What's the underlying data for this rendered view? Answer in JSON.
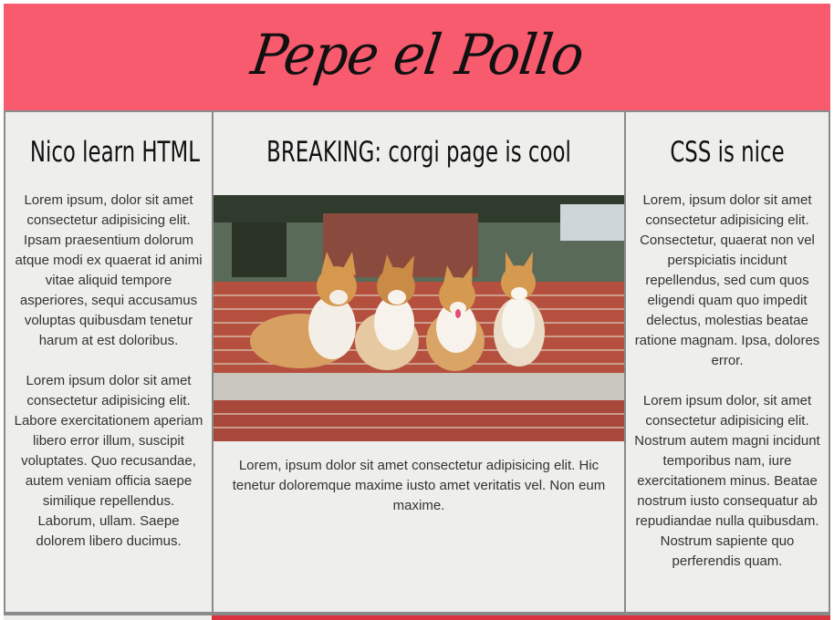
{
  "header": {
    "title": "Pepe el Pollo",
    "background_color": "#f85a6e"
  },
  "columns": {
    "left": {
      "heading": "Nico learn HTML",
      "paragraphs": [
        "Lorem ipsum, dolor sit amet consectetur adipisicing elit. Ipsam praesentium dolorum atque modi ex quaerat id animi vitae aliquid tempore asperiores, sequi accusamus voluptas quibusdam tenetur harum at est doloribus.",
        "Lorem ipsum dolor sit amet consectetur adipisicing elit. Labore exercitationem aperiam libero error illum, suscipit voluptates. Quo recusandae, autem veniam officia saepe similique repellendus. Laborum, ullam. Saepe dolorem libero ducimus."
      ]
    },
    "middle": {
      "heading": "BREAKING: corgi page is cool",
      "image_alt": "four corgis sitting on a brick bench",
      "paragraph": "Lorem, ipsum dolor sit amet consectetur adipisicing elit. Hic tenetur doloremque maxime iusto amet veritatis vel. Non eum maxime."
    },
    "right": {
      "heading": "CSS is nice",
      "paragraphs": [
        "Lorem, ipsum dolor sit amet consectetur adipisicing elit. Consectetur, quaerat non vel perspiciatis incidunt repellendus, sed cum quos eligendi quam quo impedit delectus, molestias beatae ratione magnam. Ipsa, dolores error.",
        "Lorem ipsum dolor, sit amet consectetur adipisicing elit. Nostrum autem magni incidunt temporibus nam, iure exercitationem minus. Beatae nostrum iusto consequatur ab repudiandae nulla quibusdam. Nostrum sapiente quo perferendis quam."
      ]
    }
  },
  "colors": {
    "column_background": "#eeeeec",
    "border": "#8a8a8a",
    "footer_accent": "#d9333d"
  }
}
